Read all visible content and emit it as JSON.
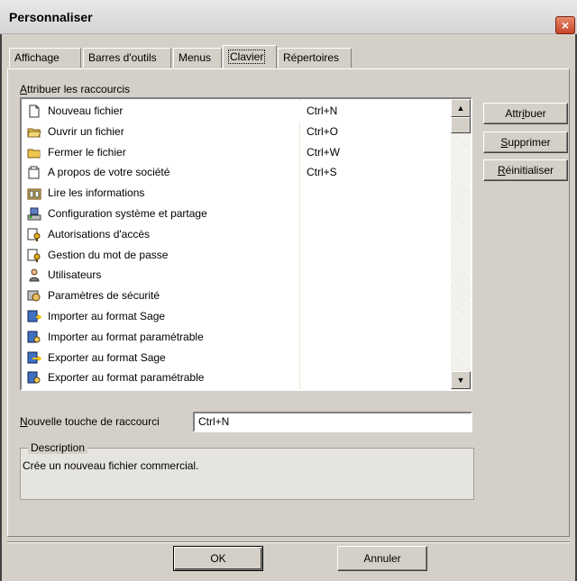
{
  "window": {
    "title": "Personnaliser",
    "close_glyph": "×"
  },
  "tabs": [
    {
      "label": "Affichage",
      "active": false
    },
    {
      "label": "Barres d'outils",
      "active": false
    },
    {
      "label": "Menus",
      "active": false
    },
    {
      "label": "Clavier",
      "active": true
    },
    {
      "label": "Répertoires",
      "active": false
    }
  ],
  "shortcuts_section": {
    "label_ul": "A",
    "label_rest": "ttribuer les raccourcis"
  },
  "commands": [
    {
      "name": "Nouveau fichier",
      "key": "Ctrl+N",
      "icon": "new-file-icon"
    },
    {
      "name": "Ouvrir un fichier",
      "key": "Ctrl+O",
      "icon": "open-folder-icon"
    },
    {
      "name": "Fermer le fichier",
      "key": "Ctrl+W",
      "icon": "close-folder-icon"
    },
    {
      "name": "A propos de votre société",
      "key": "Ctrl+S",
      "icon": "company-icon"
    },
    {
      "name": "Lire les informations",
      "key": "",
      "icon": "read-info-icon"
    },
    {
      "name": "Configuration système et partage",
      "key": "",
      "icon": "system-config-icon"
    },
    {
      "name": "Autorisations d'accès",
      "key": "",
      "icon": "access-key-icon"
    },
    {
      "name": "Gestion du mot de passe",
      "key": "",
      "icon": "password-key-icon"
    },
    {
      "name": "Utilisateurs",
      "key": "",
      "icon": "users-icon"
    },
    {
      "name": "Paramètres de sécurité",
      "key": "",
      "icon": "security-icon"
    },
    {
      "name": "Importer au format Sage",
      "key": "",
      "icon": "import-icon"
    },
    {
      "name": "Importer au format paramétrable",
      "key": "",
      "icon": "import-custom-icon"
    },
    {
      "name": "Exporter au format Sage",
      "key": "",
      "icon": "export-icon"
    },
    {
      "name": "Exporter au format paramétrable",
      "key": "",
      "icon": "export-custom-icon"
    }
  ],
  "scrollbar": {
    "up_glyph": "▲",
    "down_glyph": "▼"
  },
  "side_buttons": {
    "assign": {
      "pre": "Attr",
      "ul": "i",
      "post": "buer"
    },
    "delete": {
      "pre": "",
      "ul": "S",
      "post": "upprimer"
    },
    "reset": {
      "pre": "",
      "ul": "R",
      "post": "éinitialiser"
    }
  },
  "new_shortcut": {
    "label_ul": "N",
    "label_rest": "ouvelle touche de raccourci",
    "value": "Ctrl+N"
  },
  "description": {
    "legend": "Description",
    "text": "Crée un nouveau fichier commercial."
  },
  "footer": {
    "ok_label": "OK",
    "cancel_label": "Annuler"
  }
}
